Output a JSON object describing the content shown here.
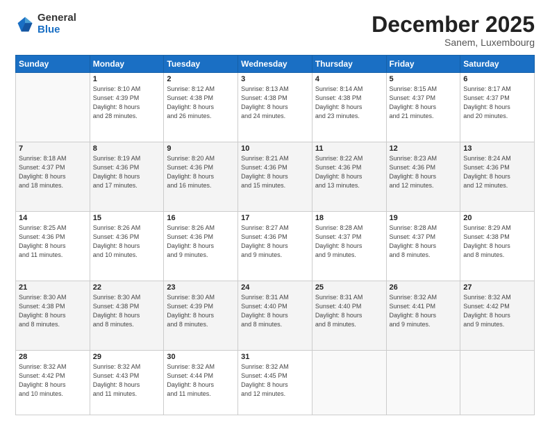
{
  "logo": {
    "general": "General",
    "blue": "Blue"
  },
  "title": "December 2025",
  "subtitle": "Sanem, Luxembourg",
  "days_header": [
    "Sunday",
    "Monday",
    "Tuesday",
    "Wednesday",
    "Thursday",
    "Friday",
    "Saturday"
  ],
  "weeks": [
    [
      {
        "num": "",
        "info": ""
      },
      {
        "num": "1",
        "info": "Sunrise: 8:10 AM\nSunset: 4:39 PM\nDaylight: 8 hours\nand 28 minutes."
      },
      {
        "num": "2",
        "info": "Sunrise: 8:12 AM\nSunset: 4:38 PM\nDaylight: 8 hours\nand 26 minutes."
      },
      {
        "num": "3",
        "info": "Sunrise: 8:13 AM\nSunset: 4:38 PM\nDaylight: 8 hours\nand 24 minutes."
      },
      {
        "num": "4",
        "info": "Sunrise: 8:14 AM\nSunset: 4:38 PM\nDaylight: 8 hours\nand 23 minutes."
      },
      {
        "num": "5",
        "info": "Sunrise: 8:15 AM\nSunset: 4:37 PM\nDaylight: 8 hours\nand 21 minutes."
      },
      {
        "num": "6",
        "info": "Sunrise: 8:17 AM\nSunset: 4:37 PM\nDaylight: 8 hours\nand 20 minutes."
      }
    ],
    [
      {
        "num": "7",
        "info": "Sunrise: 8:18 AM\nSunset: 4:37 PM\nDaylight: 8 hours\nand 18 minutes."
      },
      {
        "num": "8",
        "info": "Sunrise: 8:19 AM\nSunset: 4:36 PM\nDaylight: 8 hours\nand 17 minutes."
      },
      {
        "num": "9",
        "info": "Sunrise: 8:20 AM\nSunset: 4:36 PM\nDaylight: 8 hours\nand 16 minutes."
      },
      {
        "num": "10",
        "info": "Sunrise: 8:21 AM\nSunset: 4:36 PM\nDaylight: 8 hours\nand 15 minutes."
      },
      {
        "num": "11",
        "info": "Sunrise: 8:22 AM\nSunset: 4:36 PM\nDaylight: 8 hours\nand 13 minutes."
      },
      {
        "num": "12",
        "info": "Sunrise: 8:23 AM\nSunset: 4:36 PM\nDaylight: 8 hours\nand 12 minutes."
      },
      {
        "num": "13",
        "info": "Sunrise: 8:24 AM\nSunset: 4:36 PM\nDaylight: 8 hours\nand 12 minutes."
      }
    ],
    [
      {
        "num": "14",
        "info": "Sunrise: 8:25 AM\nSunset: 4:36 PM\nDaylight: 8 hours\nand 11 minutes."
      },
      {
        "num": "15",
        "info": "Sunrise: 8:26 AM\nSunset: 4:36 PM\nDaylight: 8 hours\nand 10 minutes."
      },
      {
        "num": "16",
        "info": "Sunrise: 8:26 AM\nSunset: 4:36 PM\nDaylight: 8 hours\nand 9 minutes."
      },
      {
        "num": "17",
        "info": "Sunrise: 8:27 AM\nSunset: 4:36 PM\nDaylight: 8 hours\nand 9 minutes."
      },
      {
        "num": "18",
        "info": "Sunrise: 8:28 AM\nSunset: 4:37 PM\nDaylight: 8 hours\nand 9 minutes."
      },
      {
        "num": "19",
        "info": "Sunrise: 8:28 AM\nSunset: 4:37 PM\nDaylight: 8 hours\nand 8 minutes."
      },
      {
        "num": "20",
        "info": "Sunrise: 8:29 AM\nSunset: 4:38 PM\nDaylight: 8 hours\nand 8 minutes."
      }
    ],
    [
      {
        "num": "21",
        "info": "Sunrise: 8:30 AM\nSunset: 4:38 PM\nDaylight: 8 hours\nand 8 minutes."
      },
      {
        "num": "22",
        "info": "Sunrise: 8:30 AM\nSunset: 4:38 PM\nDaylight: 8 hours\nand 8 minutes."
      },
      {
        "num": "23",
        "info": "Sunrise: 8:30 AM\nSunset: 4:39 PM\nDaylight: 8 hours\nand 8 minutes."
      },
      {
        "num": "24",
        "info": "Sunrise: 8:31 AM\nSunset: 4:40 PM\nDaylight: 8 hours\nand 8 minutes."
      },
      {
        "num": "25",
        "info": "Sunrise: 8:31 AM\nSunset: 4:40 PM\nDaylight: 8 hours\nand 8 minutes."
      },
      {
        "num": "26",
        "info": "Sunrise: 8:32 AM\nSunset: 4:41 PM\nDaylight: 8 hours\nand 9 minutes."
      },
      {
        "num": "27",
        "info": "Sunrise: 8:32 AM\nSunset: 4:42 PM\nDaylight: 8 hours\nand 9 minutes."
      }
    ],
    [
      {
        "num": "28",
        "info": "Sunrise: 8:32 AM\nSunset: 4:42 PM\nDaylight: 8 hours\nand 10 minutes."
      },
      {
        "num": "29",
        "info": "Sunrise: 8:32 AM\nSunset: 4:43 PM\nDaylight: 8 hours\nand 11 minutes."
      },
      {
        "num": "30",
        "info": "Sunrise: 8:32 AM\nSunset: 4:44 PM\nDaylight: 8 hours\nand 11 minutes."
      },
      {
        "num": "31",
        "info": "Sunrise: 8:32 AM\nSunset: 4:45 PM\nDaylight: 8 hours\nand 12 minutes."
      },
      {
        "num": "",
        "info": ""
      },
      {
        "num": "",
        "info": ""
      },
      {
        "num": "",
        "info": ""
      }
    ]
  ]
}
